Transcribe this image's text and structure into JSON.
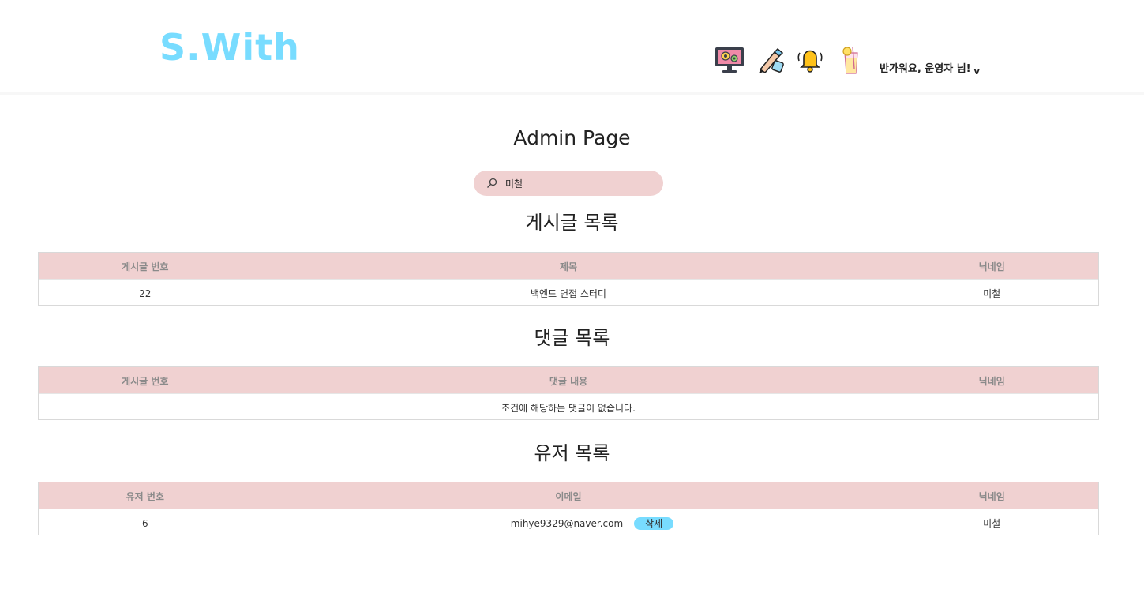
{
  "header": {
    "logo": "S.With",
    "icons": [
      "monitor-settings-icon",
      "pen-write-icon",
      "bell-icon",
      "lemonade-drink-icon"
    ],
    "greeting": "반가워요, 운영자 님!",
    "greeting_caret": "v"
  },
  "main": {
    "title": "Admin Page",
    "search": {
      "value": "미철"
    }
  },
  "posts": {
    "title": "게시글 목록",
    "columns": [
      "게시글 번호",
      "제목",
      "닉네임"
    ],
    "rows": [
      {
        "id": "22",
        "title": "백엔드 면접 스터디",
        "nickname": "미철"
      }
    ]
  },
  "comments": {
    "title": "댓글 목록",
    "columns": [
      "게시글 번호",
      "댓글 내용",
      "닉네임"
    ],
    "empty_message": "조건에 해당하는 댓글이 없습니다."
  },
  "users": {
    "title": "유저 목록",
    "columns": [
      "유저 번호",
      "이메일",
      "닉네임"
    ],
    "rows": [
      {
        "id": "6",
        "email": "mihye9329@naver.com",
        "delete_label": "삭제",
        "nickname": "미철"
      }
    ]
  },
  "colors": {
    "brand": "#78dcff",
    "table_header": "#f0d1d1",
    "search_bg": "#f0d1d1"
  }
}
